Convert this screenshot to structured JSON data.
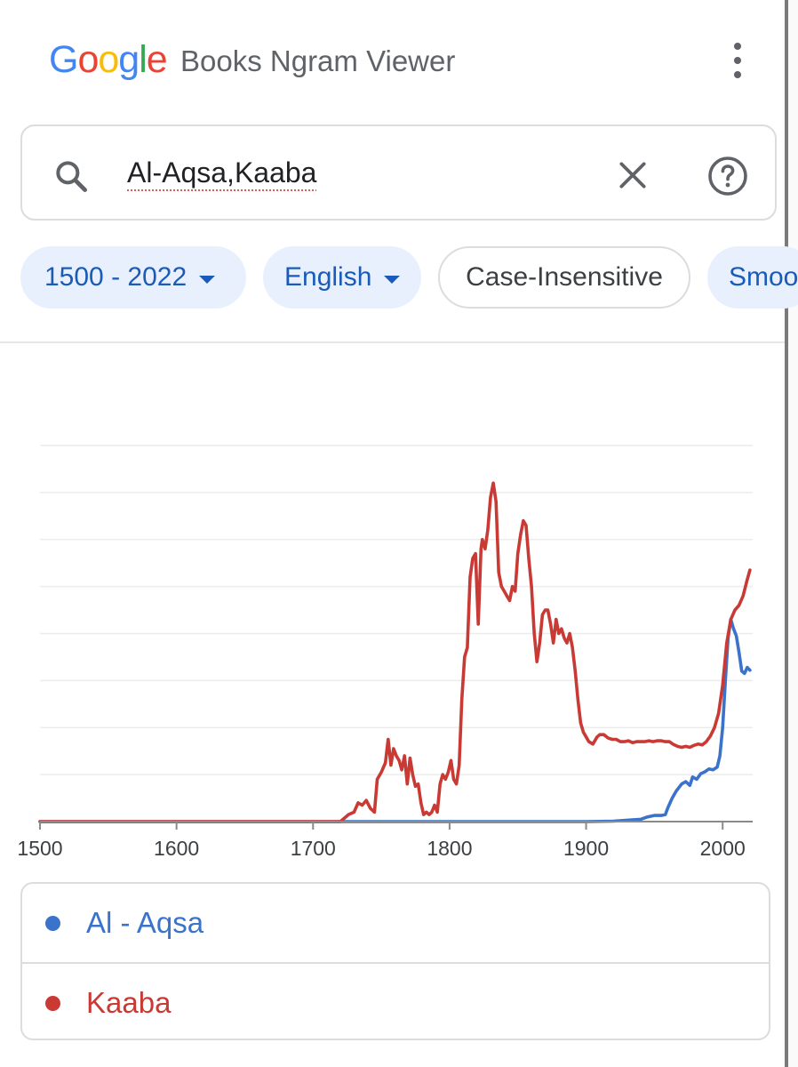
{
  "header": {
    "logo_letters": [
      "G",
      "o",
      "o",
      "g",
      "l",
      "e"
    ],
    "logo_colors": [
      "#4285F4",
      "#EA4335",
      "#FBBC05",
      "#4285F4",
      "#34A853",
      "#EA4335"
    ],
    "title": "Books Ngram Viewer",
    "menu_icon": "more-vert-icon"
  },
  "search": {
    "value": "Al-Aqsa,Kaaba",
    "search_icon": "search-icon",
    "clear_icon": "close-icon",
    "help_icon": "help-icon"
  },
  "filters": {
    "date_range": "1500 - 2022",
    "language": "English",
    "case": "Case-Insensitive",
    "smoothing": "Smoo"
  },
  "colors": {
    "accent": "#1a5bb8",
    "chip_bg": "#e8f0fe",
    "series_al_aqsa": "#3a73c9",
    "series_kaaba": "#c93a35"
  },
  "chart_data": {
    "type": "line",
    "xlim": [
      1500,
      2022
    ],
    "ylim": [
      0,
      8
    ],
    "x_ticks": [
      "1500",
      "1600",
      "1700",
      "1800",
      "1900",
      "2000"
    ],
    "grid": "horizontal",
    "series": [
      {
        "name": "Al - Aqsa",
        "color": "#3a73c9",
        "points": [
          [
            1500,
            0
          ],
          [
            1700,
            0
          ],
          [
            1800,
            0
          ],
          [
            1900,
            0
          ],
          [
            1920,
            0.01
          ],
          [
            1935,
            0.04
          ],
          [
            1940,
            0.05
          ],
          [
            1945,
            0.1
          ],
          [
            1950,
            0.13
          ],
          [
            1955,
            0.13
          ],
          [
            1958,
            0.15
          ],
          [
            1960,
            0.3
          ],
          [
            1963,
            0.5
          ],
          [
            1966,
            0.65
          ],
          [
            1970,
            0.8
          ],
          [
            1973,
            0.85
          ],
          [
            1976,
            0.77
          ],
          [
            1978,
            0.95
          ],
          [
            1981,
            0.9
          ],
          [
            1984,
            1.02
          ],
          [
            1987,
            1.06
          ],
          [
            1990,
            1.12
          ],
          [
            1993,
            1.1
          ],
          [
            1996,
            1.16
          ],
          [
            1998,
            1.4
          ],
          [
            2000,
            2.0
          ],
          [
            2002,
            3.0
          ],
          [
            2004,
            3.9
          ],
          [
            2006,
            4.3
          ],
          [
            2008,
            4.1
          ],
          [
            2010,
            3.95
          ],
          [
            2012,
            3.6
          ],
          [
            2014,
            3.2
          ],
          [
            2016,
            3.15
          ],
          [
            2018,
            3.28
          ],
          [
            2020,
            3.22
          ]
        ]
      },
      {
        "name": "Kaaba",
        "color": "#c93a35",
        "points": [
          [
            1500,
            0
          ],
          [
            1720,
            0
          ],
          [
            1726,
            0.15
          ],
          [
            1730,
            0.2
          ],
          [
            1733,
            0.4
          ],
          [
            1736,
            0.35
          ],
          [
            1739,
            0.45
          ],
          [
            1742,
            0.28
          ],
          [
            1745,
            0.2
          ],
          [
            1747,
            0.9
          ],
          [
            1750,
            1.05
          ],
          [
            1753,
            1.25
          ],
          [
            1755,
            1.75
          ],
          [
            1757,
            1.2
          ],
          [
            1759,
            1.55
          ],
          [
            1761,
            1.4
          ],
          [
            1763,
            1.3
          ],
          [
            1765,
            1.1
          ],
          [
            1767,
            1.4
          ],
          [
            1769,
            0.8
          ],
          [
            1771,
            1.35
          ],
          [
            1773,
            1.0
          ],
          [
            1775,
            0.75
          ],
          [
            1777,
            0.8
          ],
          [
            1779,
            0.4
          ],
          [
            1781,
            0.15
          ],
          [
            1783,
            0.2
          ],
          [
            1785,
            0.15
          ],
          [
            1787,
            0.2
          ],
          [
            1789,
            0.35
          ],
          [
            1791,
            0.2
          ],
          [
            1793,
            0.8
          ],
          [
            1795,
            1.0
          ],
          [
            1797,
            0.9
          ],
          [
            1799,
            1.05
          ],
          [
            1801,
            1.3
          ],
          [
            1803,
            0.9
          ],
          [
            1805,
            0.8
          ],
          [
            1807,
            1.2
          ],
          [
            1809,
            2.6
          ],
          [
            1811,
            3.5
          ],
          [
            1813,
            3.7
          ],
          [
            1815,
            5.2
          ],
          [
            1817,
            5.6
          ],
          [
            1819,
            5.7
          ],
          [
            1821,
            4.2
          ],
          [
            1823,
            5.8
          ],
          [
            1824,
            6.0
          ],
          [
            1826,
            5.8
          ],
          [
            1828,
            6.2
          ],
          [
            1830,
            6.9
          ],
          [
            1832,
            7.2
          ],
          [
            1834,
            6.8
          ],
          [
            1836,
            5.3
          ],
          [
            1838,
            5.0
          ],
          [
            1840,
            4.9
          ],
          [
            1842,
            4.8
          ],
          [
            1844,
            4.7
          ],
          [
            1846,
            5.0
          ],
          [
            1848,
            4.9
          ],
          [
            1850,
            5.7
          ],
          [
            1852,
            6.1
          ],
          [
            1854,
            6.4
          ],
          [
            1856,
            6.3
          ],
          [
            1858,
            5.6
          ],
          [
            1860,
            5.0
          ],
          [
            1862,
            4.0
          ],
          [
            1864,
            3.4
          ],
          [
            1866,
            3.8
          ],
          [
            1868,
            4.4
          ],
          [
            1870,
            4.5
          ],
          [
            1872,
            4.5
          ],
          [
            1874,
            4.2
          ],
          [
            1876,
            3.8
          ],
          [
            1878,
            4.3
          ],
          [
            1880,
            4.0
          ],
          [
            1882,
            4.1
          ],
          [
            1884,
            3.9
          ],
          [
            1886,
            3.8
          ],
          [
            1888,
            4.0
          ],
          [
            1890,
            3.7
          ],
          [
            1892,
            3.2
          ],
          [
            1894,
            2.6
          ],
          [
            1896,
            2.1
          ],
          [
            1898,
            1.9
          ],
          [
            1900,
            1.8
          ],
          [
            1902,
            1.7
          ],
          [
            1905,
            1.65
          ],
          [
            1908,
            1.8
          ],
          [
            1910,
            1.85
          ],
          [
            1913,
            1.85
          ],
          [
            1916,
            1.78
          ],
          [
            1919,
            1.75
          ],
          [
            1922,
            1.75
          ],
          [
            1925,
            1.7
          ],
          [
            1928,
            1.7
          ],
          [
            1931,
            1.72
          ],
          [
            1934,
            1.68
          ],
          [
            1937,
            1.7
          ],
          [
            1940,
            1.7
          ],
          [
            1943,
            1.7
          ],
          [
            1946,
            1.72
          ],
          [
            1949,
            1.7
          ],
          [
            1952,
            1.72
          ],
          [
            1955,
            1.72
          ],
          [
            1958,
            1.7
          ],
          [
            1961,
            1.7
          ],
          [
            1964,
            1.64
          ],
          [
            1967,
            1.6
          ],
          [
            1970,
            1.58
          ],
          [
            1973,
            1.6
          ],
          [
            1976,
            1.58
          ],
          [
            1979,
            1.62
          ],
          [
            1982,
            1.65
          ],
          [
            1985,
            1.63
          ],
          [
            1988,
            1.7
          ],
          [
            1991,
            1.82
          ],
          [
            1994,
            2.0
          ],
          [
            1997,
            2.3
          ],
          [
            2000,
            2.9
          ],
          [
            2003,
            3.8
          ],
          [
            2006,
            4.3
          ],
          [
            2009,
            4.5
          ],
          [
            2012,
            4.6
          ],
          [
            2015,
            4.8
          ],
          [
            2018,
            5.15
          ],
          [
            2020,
            5.35
          ]
        ]
      }
    ]
  },
  "legend": [
    {
      "label": "Al - Aqsa",
      "color": "#3a73c9"
    },
    {
      "label": "Kaaba",
      "color": "#c93a35"
    }
  ]
}
